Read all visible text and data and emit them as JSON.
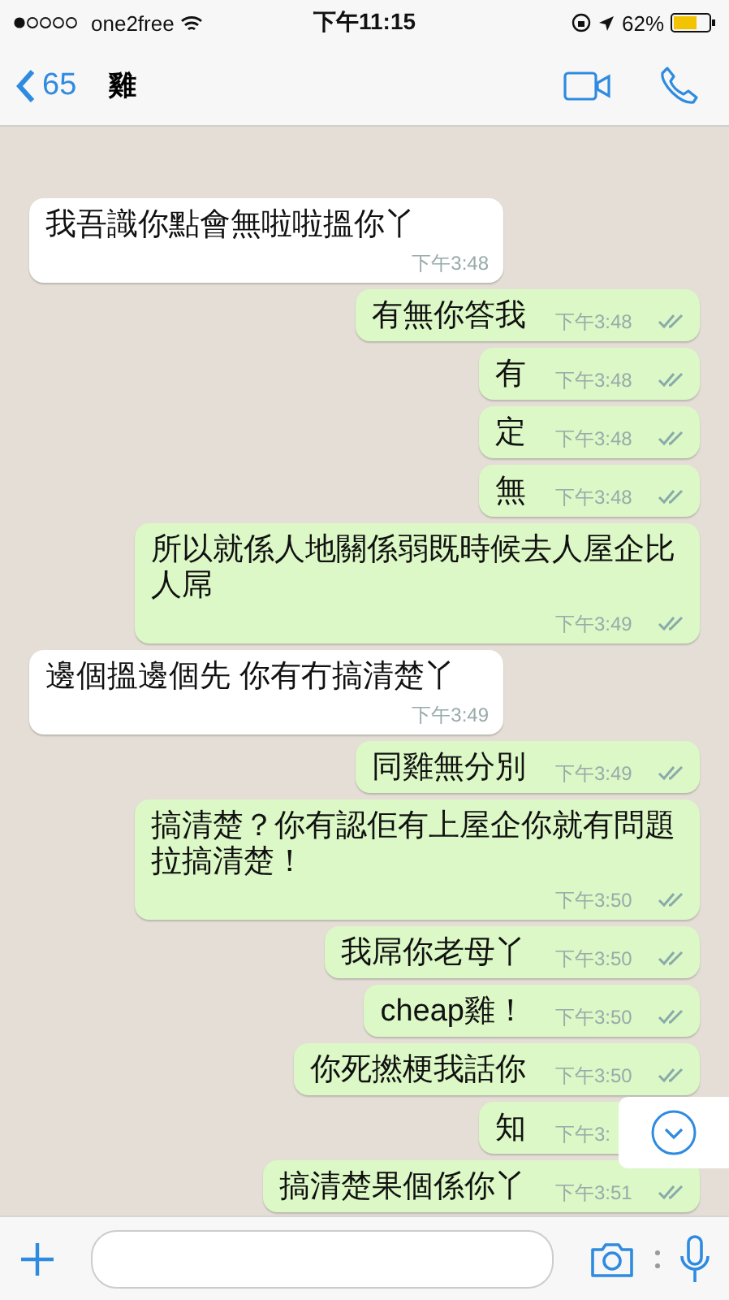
{
  "status_bar": {
    "carrier": "one2free",
    "time": "下午11:15",
    "battery": "62%"
  },
  "nav": {
    "back_count": "65",
    "title": "雞"
  },
  "messages": [
    {
      "kind": "incoming",
      "text": "我吾識你點會無啦啦搵你丫",
      "time": "下午3:48",
      "ticks": false
    },
    {
      "kind": "outgoing",
      "text": "有無你答我",
      "time": "下午3:48",
      "ticks": true
    },
    {
      "kind": "outgoing",
      "text": "有",
      "time": "下午3:48",
      "ticks": true
    },
    {
      "kind": "outgoing",
      "text": "定",
      "time": "下午3:48",
      "ticks": true
    },
    {
      "kind": "outgoing",
      "text": "無",
      "time": "下午3:48",
      "ticks": true
    },
    {
      "kind": "outgoing",
      "text": "所以就係人地關係弱既時候去人屋企比人屌",
      "time": "下午3:49",
      "ticks": true
    },
    {
      "kind": "incoming",
      "text": "邊個搵邊個先 你有冇搞清楚丫",
      "time": "下午3:49",
      "ticks": false
    },
    {
      "kind": "outgoing",
      "text": "同雞無分別",
      "time": "下午3:49",
      "ticks": true
    },
    {
      "kind": "outgoing",
      "text": "搞清楚？你有認佢有上屋企你就有問題拉搞清楚！",
      "time": "下午3:50",
      "ticks": true
    },
    {
      "kind": "outgoing",
      "text": "我屌你老母丫",
      "time": "下午3:50",
      "ticks": true
    },
    {
      "kind": "outgoing",
      "text": "cheap雞！",
      "time": "下午3:50",
      "ticks": true
    },
    {
      "kind": "outgoing",
      "text": "你死撚梗我話你",
      "time": "下午3:50",
      "ticks": true
    },
    {
      "kind": "outgoing",
      "text": "知",
      "time": "下午3:",
      "ticks": false
    },
    {
      "kind": "outgoing",
      "text": "搞清楚果個係你丫",
      "time": "下午3:51",
      "ticks": true
    }
  ]
}
